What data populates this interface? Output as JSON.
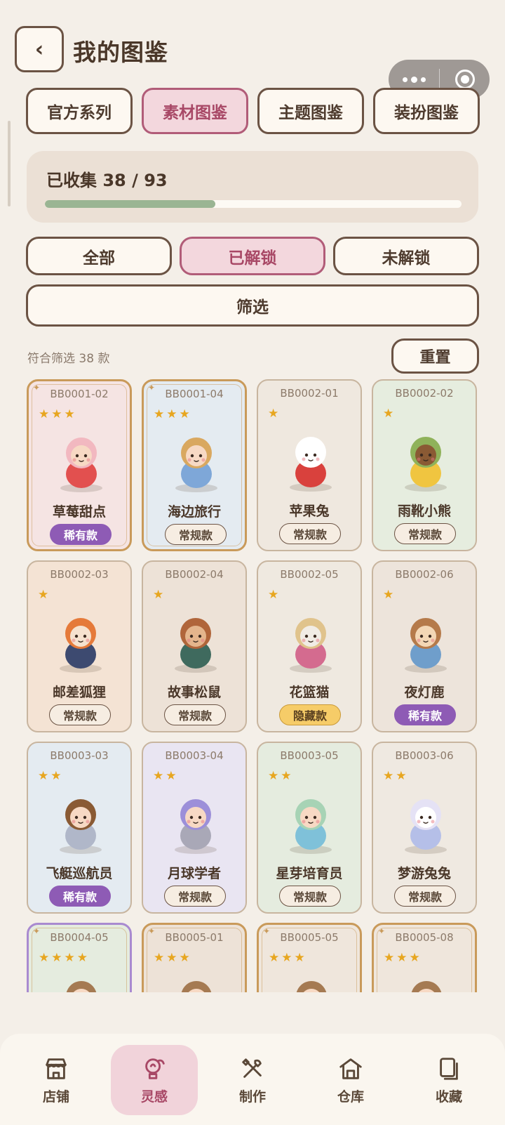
{
  "header": {
    "back_label": "‹",
    "title": "我的图鉴"
  },
  "tabs": [
    {
      "label": "官方系列",
      "active": false
    },
    {
      "label": "素材图鉴",
      "active": true
    },
    {
      "label": "主题图鉴",
      "active": false
    },
    {
      "label": "装扮图鉴",
      "active": false
    }
  ],
  "progress": {
    "label": "已收集 38 / 93",
    "collected": 38,
    "total": 93,
    "fill_color": "#9ab593"
  },
  "segments": [
    {
      "label": "全部",
      "active": false
    },
    {
      "label": "已解锁",
      "active": true
    },
    {
      "label": "未解锁",
      "active": false
    }
  ],
  "filter_label": "筛选",
  "match_text": "符合筛选 38 款",
  "reset_label": "重置",
  "items": [
    {
      "code": "BB0001-02",
      "stars": "★★★",
      "name": "草莓甜点",
      "badge": "稀有款",
      "badge_type": "rare",
      "bg": "#f5e4e3",
      "frame": "gold",
      "figure": "strawberry-girl"
    },
    {
      "code": "BB0001-04",
      "stars": "★★★",
      "name": "海边旅行",
      "badge": "常规款",
      "badge_type": "normal",
      "bg": "#e4ebf1",
      "frame": "gold",
      "figure": "beach-girl"
    },
    {
      "code": "BB0002-01",
      "stars": "★",
      "name": "苹果兔",
      "badge": "常规款",
      "badge_type": "normal",
      "bg": "#efe8df",
      "frame": "plain",
      "figure": "apple-bunny"
    },
    {
      "code": "BB0002-02",
      "stars": "★",
      "name": "雨靴小熊",
      "badge": "常规款",
      "badge_type": "normal",
      "bg": "#e6eddf",
      "frame": "plain",
      "figure": "rain-bear"
    },
    {
      "code": "BB0002-03",
      "stars": "★",
      "name": "邮差狐狸",
      "badge": "常规款",
      "badge_type": "normal",
      "bg": "#f4e3d4",
      "frame": "plain",
      "figure": "postman-fox"
    },
    {
      "code": "BB0002-04",
      "stars": "★",
      "name": "故事松鼠",
      "badge": "常规款",
      "badge_type": "normal",
      "bg": "#ede2d7",
      "frame": "plain",
      "figure": "story-squirrel"
    },
    {
      "code": "BB0002-05",
      "stars": "★",
      "name": "花篮猫",
      "badge": "隐藏款",
      "badge_type": "hidden",
      "bg": "#efe9e0",
      "frame": "plain",
      "figure": "basket-cat"
    },
    {
      "code": "BB0002-06",
      "stars": "★",
      "name": "夜灯鹿",
      "badge": "稀有款",
      "badge_type": "rare",
      "bg": "#ede4db",
      "frame": "plain",
      "figure": "lantern-deer"
    },
    {
      "code": "BB0003-03",
      "stars": "★★",
      "name": "飞艇巡航员",
      "badge": "稀有款",
      "badge_type": "rare",
      "bg": "#e4ebf1",
      "frame": "plain",
      "figure": "pilot-girl"
    },
    {
      "code": "BB0003-04",
      "stars": "★★",
      "name": "月球学者",
      "badge": "常规款",
      "badge_type": "normal",
      "bg": "#e9e5f2",
      "frame": "plain",
      "figure": "moon-scholar"
    },
    {
      "code": "BB0003-05",
      "stars": "★★",
      "name": "星芽培育员",
      "badge": "常规款",
      "badge_type": "normal",
      "bg": "#e5ecdf",
      "frame": "plain",
      "figure": "sprout-girl"
    },
    {
      "code": "BB0003-06",
      "stars": "★★",
      "name": "梦游兔兔",
      "badge": "常规款",
      "badge_type": "normal",
      "bg": "#efe9e1",
      "frame": "plain",
      "figure": "dream-bunny"
    },
    {
      "code": "BB0004-05",
      "stars": "★★★★",
      "name": "",
      "badge": "",
      "badge_type": "none",
      "bg": "#e5ecdf",
      "frame": "purple",
      "figure": "hat-figure"
    },
    {
      "code": "BB0005-01",
      "stars": "★★★",
      "name": "",
      "badge": "",
      "badge_type": "none",
      "bg": "#ede2d7",
      "frame": "gold",
      "figure": "hat-figure"
    },
    {
      "code": "BB0005-05",
      "stars": "★★★",
      "name": "",
      "badge": "",
      "badge_type": "none",
      "bg": "#efe6dc",
      "frame": "gold",
      "figure": "hat-figure"
    },
    {
      "code": "BB0005-08",
      "stars": "★★★",
      "name": "",
      "badge": "",
      "badge_type": "none",
      "bg": "#efe6dc",
      "frame": "gold",
      "figure": "hat-figure"
    }
  ],
  "nav": [
    {
      "label": "店铺",
      "icon": "store-icon",
      "active": false
    },
    {
      "label": "灵感",
      "icon": "bulb-icon",
      "active": true
    },
    {
      "label": "制作",
      "icon": "tools-icon",
      "active": false
    },
    {
      "label": "仓库",
      "icon": "warehouse-icon",
      "active": false
    },
    {
      "label": "收藏",
      "icon": "collection-icon",
      "active": false
    }
  ]
}
